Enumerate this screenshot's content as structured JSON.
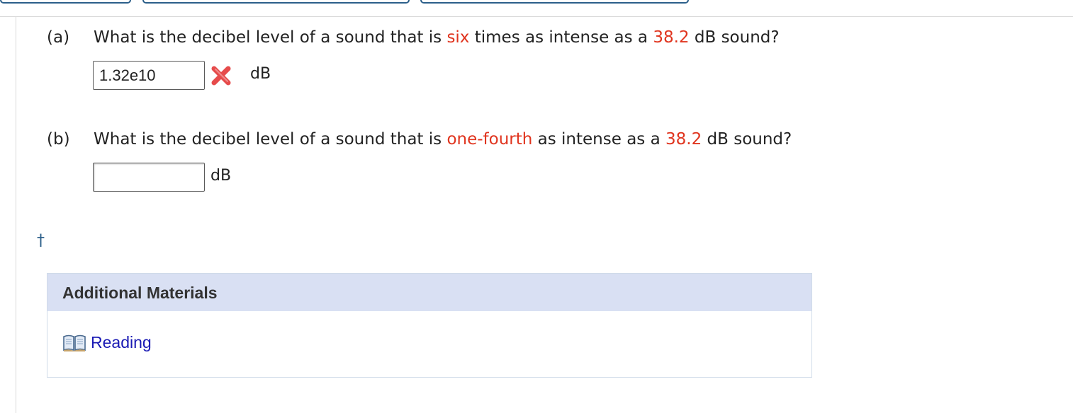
{
  "part_a": {
    "label": "(a)",
    "question_prefix": "What is the decibel level of a sound that is",
    "highlight_factor": "six",
    "question_middle": "times as intense as a",
    "highlight_level": "38.2",
    "question_suffix": "dB sound?",
    "answer_value": "1.32e10",
    "answer_status": "incorrect",
    "unit": "dB"
  },
  "part_b": {
    "label": "(b)",
    "question_prefix": "What is the decibel level of a sound that is",
    "highlight_factor": "one-fourth",
    "question_middle": "as intense as a",
    "highlight_level": "38.2",
    "question_suffix": "dB sound?",
    "answer_value": "",
    "unit": "dB"
  },
  "footnote_marker": "†",
  "additional_materials": {
    "title": "Additional Materials",
    "links": [
      {
        "label": "Reading",
        "icon": "book-icon"
      }
    ]
  },
  "colors": {
    "highlight": "#e0341e",
    "link": "#1a1ab4",
    "panel_header": "#d9e0f3",
    "accent": "#2c5f8a",
    "error": "#e64b4b"
  }
}
